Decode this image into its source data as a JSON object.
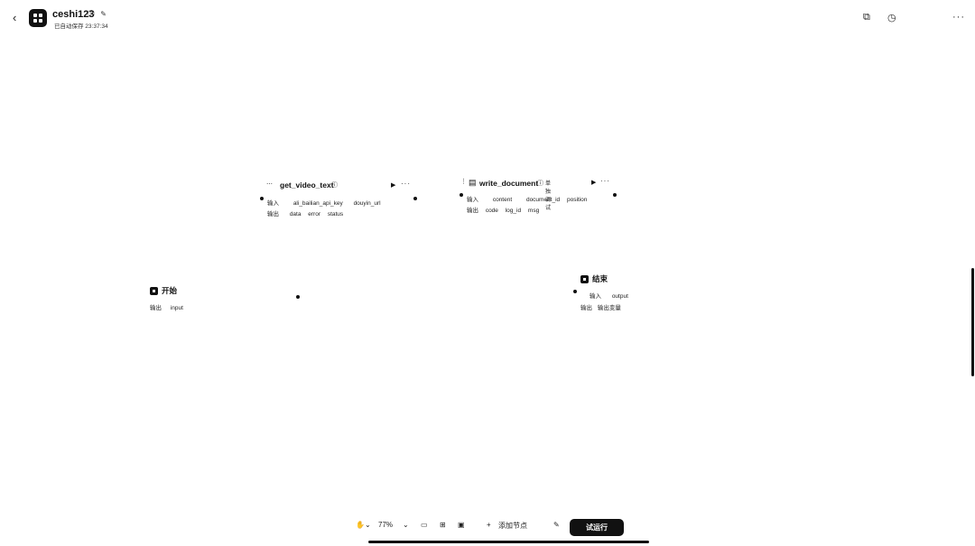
{
  "header": {
    "back_icon": "back-chevron-icon",
    "title": "ceshi123",
    "status": "已自动保存 23:37:34",
    "right_icons": [
      "copy-icon",
      "history-icon",
      "more-icon"
    ]
  },
  "nodes": {
    "video": {
      "title": "get_video_text",
      "more": "···",
      "inputs_label": "输入",
      "inputs": [
        "ali_bailian_api_key",
        "douyin_url"
      ],
      "outputs_label": "输出",
      "outputs": [
        "data",
        "error",
        "status"
      ]
    },
    "doc": {
      "title": "write_document",
      "tag": "单独调试",
      "more": "···",
      "inputs_label": "输入",
      "inputs": [
        "content",
        "document_id",
        "position"
      ],
      "outputs_label": "输出",
      "outputs": [
        "code",
        "log_id",
        "msg"
      ]
    },
    "start": {
      "title": "开始",
      "outputs_label": "输出",
      "outputs": [
        "input"
      ]
    },
    "end": {
      "title": "结束",
      "inputs_label": "输入",
      "inputs": [
        "output"
      ],
      "outputs_label": "输出",
      "output_var": "输出变量"
    }
  },
  "toolbar": {
    "zoom": "77%",
    "add_node": "添加节点",
    "run": "试运行"
  }
}
